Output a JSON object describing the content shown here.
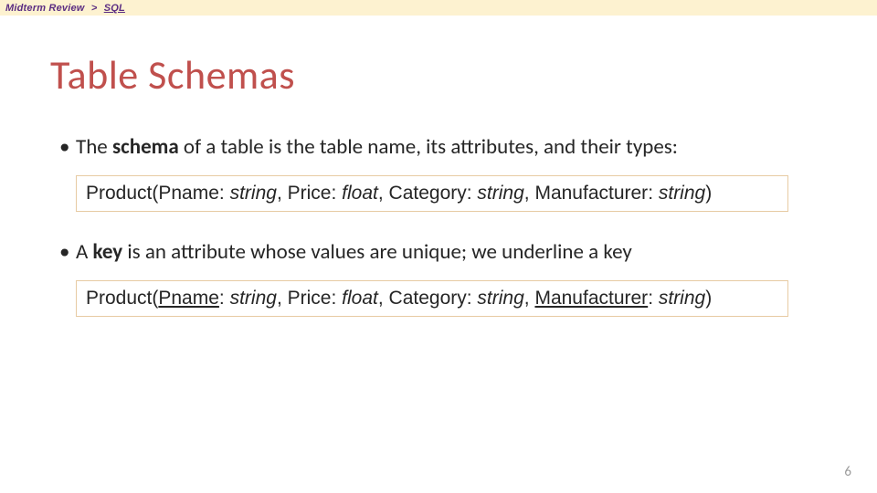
{
  "breadcrumb": {
    "parent": "Midterm Review",
    "sep": ">",
    "current": "SQL"
  },
  "title": "Table Schemas",
  "bullet1": {
    "pre": "The ",
    "bold": "schema",
    "post": " of a table is the table name, its attributes, and their types:"
  },
  "schema1": {
    "prefix": "Product(",
    "a1": "Pname",
    "a1t": "string",
    "a2": "Price",
    "a2t": "float",
    "a3": "Category",
    "a3t": "string",
    "a4": "Manufacturer",
    "a4t": "string",
    "suffix": ")"
  },
  "bullet2": {
    "pre": "A ",
    "bold": "key",
    "post": " is an attribute whose values are unique; we underline a key"
  },
  "schema2": {
    "prefix": "Product(",
    "a1": "Pname",
    "a1t": "string",
    "a2": "Price",
    "a2t": "float",
    "a3": "Category",
    "a3t": "string",
    "a4": "Manufacturer",
    "a4t": "string",
    "suffix": ")"
  },
  "pageNumber": "6"
}
